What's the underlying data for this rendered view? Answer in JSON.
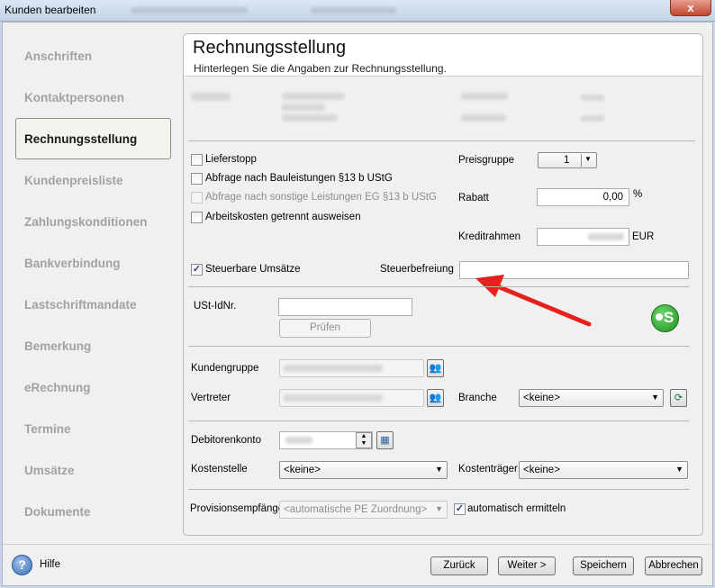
{
  "window": {
    "title": "Kunden bearbeiten",
    "close_label": "x"
  },
  "sidebar": {
    "items": [
      {
        "label": "Anschriften"
      },
      {
        "label": "Kontaktpersonen"
      },
      {
        "label": "Rechnungsstellung"
      },
      {
        "label": "Kundenpreisliste"
      },
      {
        "label": "Zahlungskonditionen"
      },
      {
        "label": "Bankverbindung"
      },
      {
        "label": "Lastschriftmandate"
      },
      {
        "label": "Bemerkung"
      },
      {
        "label": "eRechnung"
      },
      {
        "label": "Termine"
      },
      {
        "label": "Umsätze"
      },
      {
        "label": "Dokumente"
      }
    ],
    "selected": "Rechnungsstellung"
  },
  "header": {
    "title": "Rechnungsstellung",
    "subtitle": "Hinterlegen Sie die Angaben zur Rechnungsstellung."
  },
  "options": {
    "lieferstopp": {
      "label": "Lieferstopp",
      "checked": false
    },
    "bauleistungen": {
      "label": "Abfrage nach Bauleistungen §13 b UStG",
      "checked": false
    },
    "sonstige": {
      "label": "Abfrage nach sonstige Leistungen EG §13 b UStG",
      "checked": false,
      "disabled": true
    },
    "arbeitskosten": {
      "label": "Arbeitskosten getrennt ausweisen",
      "checked": false
    },
    "steuerbar": {
      "label": "Steuerbare Umsätze",
      "checked": true
    },
    "check_mark": "✓"
  },
  "pricing": {
    "preisgruppe_label": "Preisgruppe",
    "preisgruppe_value": "1",
    "rabatt_label": "Rabatt",
    "rabatt_value": "0,00",
    "rabatt_unit": "%",
    "kreditrahmen_label": "Kreditrahmen",
    "kreditrahmen_unit": "EUR"
  },
  "tax": {
    "steuerbefreiung_label": "Steuerbefreiung",
    "steuerbefreiung_value": "",
    "ust_label": "USt-IdNr.",
    "ust_value": "",
    "pruefen_label": "Prüfen",
    "badge_icon": "euro-s-badge-icon",
    "badge_color": "#2ea02e"
  },
  "assignment": {
    "kundengruppe_label": "Kundengruppe",
    "vertreter_label": "Vertreter",
    "branche_label": "Branche",
    "branche_value": "<keine>",
    "debitorenkonto_label": "Debitorenkonto",
    "kostenstelle_label": "Kostenstelle",
    "kostenstelle_value": "<keine>",
    "kostentraeger_label": "Kostenträger",
    "kostentraeger_value": "<keine>",
    "provision_label": "Provisionsempfänge",
    "provision_value": "<automatische PE Zuordnung>",
    "auto_label": "automatisch ermitteln",
    "auto_checked": true
  },
  "footer": {
    "help_label": "Hilfe",
    "help_icon": "?",
    "back_label": "Zurück",
    "next_label": "Weiter >",
    "save_label": "Speichern",
    "cancel_label": "Abbrechen"
  },
  "colors": {
    "annotation_arrow": "#e8201c",
    "accent": "#2ea02e"
  }
}
